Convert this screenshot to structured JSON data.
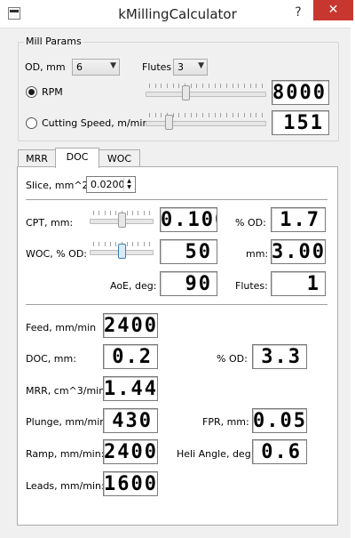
{
  "window": {
    "title": "kMillingCalculator",
    "help": "?",
    "close": "✕"
  },
  "mill_params": {
    "group_label": "Mill Params",
    "od_label": "OD, mm",
    "od_value": "6",
    "flutes_label": "Flutes",
    "flutes_value": "3",
    "rpm_label": "RPM",
    "rpm_selected": true,
    "rpm_value": "8000",
    "rpm_slider_level": 0.32,
    "cs_label": "Cutting Speed, m/min",
    "cs_selected": false,
    "cs_value": "151",
    "cs_slider_level": 0.17
  },
  "tabs": [
    {
      "label": "MRR",
      "active": false
    },
    {
      "label": "DOC",
      "active": true
    },
    {
      "label": "WOC",
      "active": false
    }
  ],
  "doc_tab": {
    "slice_label": "Slice, mm^2:",
    "slice_value": "0.0200",
    "cpt_label": "CPT, mm:",
    "cpt_value": "0.100",
    "cpt_slider_level": 0.5,
    "cpt_pct_label": "% OD:",
    "cpt_pct_value": "1.7",
    "woc_label": "WOC, % OD:",
    "woc_value": "50",
    "woc_slider_level": 0.5,
    "woc_mm_label": "mm:",
    "woc_mm_value": "3.00",
    "aoe_label": "AoE, deg:",
    "aoe_value": "90",
    "flutes_label": "Flutes:",
    "flutes_value": "1",
    "feed_label": "Feed, mm/min",
    "feed_value": "2400",
    "doc_label": "DOC, mm:",
    "doc_value": "0.2",
    "doc_pct_label": "% OD:",
    "doc_pct_value": "3.3",
    "mrr_label": "MRR, cm^3/min",
    "mrr_value": "1.44",
    "plunge_label": "Plunge, mm/min:",
    "plunge_value": "430",
    "fpr_label": "FPR, mm:",
    "fpr_value": "0.05",
    "ramp_label": "Ramp, mm/min:",
    "ramp_value": "2400",
    "heli_label": "Heli Angle, deg:",
    "heli_value": "0.6",
    "leads_label": "Leads, mm/min:",
    "leads_value": "1600"
  }
}
